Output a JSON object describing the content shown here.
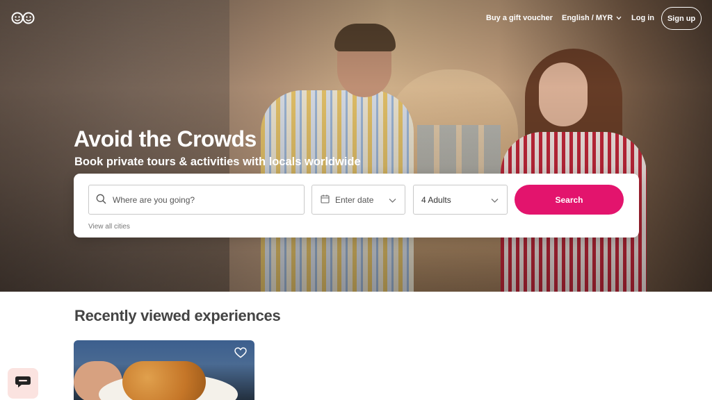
{
  "nav": {
    "gift_voucher": "Buy a gift voucher",
    "language_currency": "English / MYR",
    "login": "Log in",
    "signup": "Sign up"
  },
  "hero": {
    "title": "Avoid the Crowds",
    "subtitle": "Book private tours & activities with locals worldwide"
  },
  "search": {
    "where_placeholder": "Where are you going?",
    "date_placeholder": "Enter date",
    "guests_value": "4 Adults",
    "button_label": "Search",
    "all_cities_link": "View all cities"
  },
  "recent": {
    "heading": "Recently viewed experiences"
  },
  "icons": {
    "logo": "withlocals-logo-icon",
    "search": "search-icon",
    "calendar": "calendar-icon",
    "chevron": "chevron-down-icon",
    "heart": "heart-icon",
    "chat": "chat-icon"
  },
  "colors": {
    "accent": "#e3146d",
    "heading": "#444444",
    "chat_bg": "#fbe3e0"
  }
}
